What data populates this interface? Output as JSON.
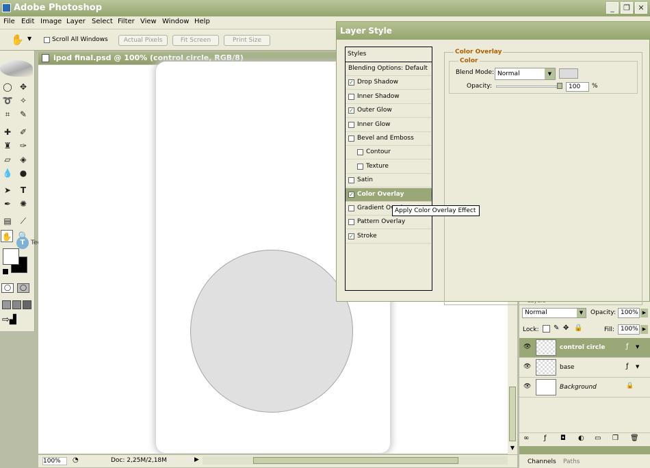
{
  "app": {
    "title": "Adobe Photoshop"
  },
  "menu": [
    "File",
    "Edit",
    "Image",
    "Layer",
    "Select",
    "Filter",
    "View",
    "Window",
    "Help"
  ],
  "options": {
    "scroll_all_label": "Scroll All Windows",
    "actual_pixels": "Actual Pixels",
    "fit_screen": "Fit Screen",
    "print_size": "Print Size"
  },
  "watermark": "TechTut.com",
  "document": {
    "title": "ipod final.psd @ 100% (control circle, RGB/8)",
    "zoom": "100%",
    "doc_info": "Doc: 2,25M/2,18M"
  },
  "dialog": {
    "title": "Layer Style",
    "styles_header": "Styles",
    "items": [
      {
        "label": "Blending Options: Default",
        "checkbox": false
      },
      {
        "label": "Drop Shadow",
        "checkbox": true,
        "checked": true
      },
      {
        "label": "Inner Shadow",
        "checkbox": true,
        "checked": false
      },
      {
        "label": "Outer Glow",
        "checkbox": true,
        "checked": true
      },
      {
        "label": "Inner Glow",
        "checkbox": true,
        "checked": false
      },
      {
        "label": "Bevel and Emboss",
        "checkbox": true,
        "checked": false
      },
      {
        "label": "Contour",
        "checkbox": true,
        "checked": false,
        "indent": true
      },
      {
        "label": "Texture",
        "checkbox": true,
        "checked": false,
        "indent": true
      },
      {
        "label": "Satin",
        "checkbox": true,
        "checked": false
      },
      {
        "label": "Color Overlay",
        "checkbox": true,
        "checked": true,
        "selected": true
      },
      {
        "label": "Gradient Overlay",
        "checkbox": true,
        "checked": false
      },
      {
        "label": "Pattern Overlay",
        "checkbox": true,
        "checked": false
      },
      {
        "label": "Stroke",
        "checkbox": true,
        "checked": true
      }
    ],
    "tooltip": "Apply Color Overlay Effect",
    "section_title": "Color Overlay",
    "subsection_title": "Color",
    "blend_mode_label": "Blend Mode:",
    "blend_mode_value": "Normal",
    "opacity_label": "Opacity:",
    "opacity_value": "100",
    "opacity_unit": "%",
    "overlay_color": "#dcdcdc"
  },
  "layers_panel": {
    "tab_label": "Layers",
    "blend_mode": "Normal",
    "opacity_label": "Opacity:",
    "opacity_value": "100%",
    "lock_label": "Lock:",
    "fill_label": "Fill:",
    "fill_value": "100%",
    "layers": [
      {
        "name": "control circle",
        "selected": true,
        "italic": false
      },
      {
        "name": "base",
        "selected": false,
        "italic": false
      },
      {
        "name": "Background",
        "selected": false,
        "italic": true
      }
    ]
  },
  "channels_panel": {
    "tabs": [
      "Channels",
      "Paths"
    ]
  },
  "colors": {
    "accent": "#94a56f",
    "selected_row": "#9aa877"
  }
}
